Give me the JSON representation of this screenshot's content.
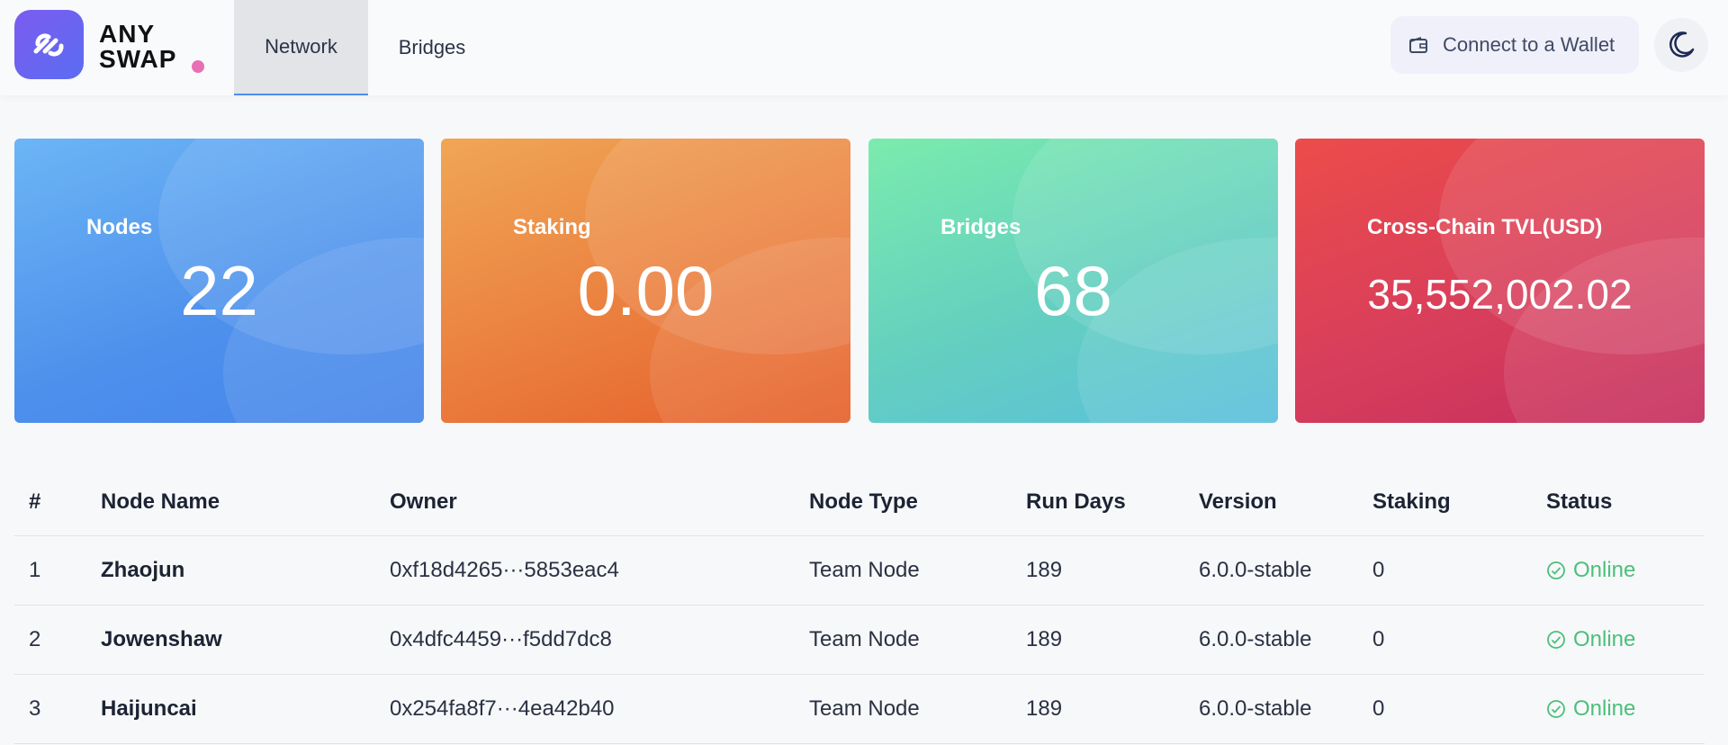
{
  "brand": {
    "line1": "ANY",
    "line2": "SWAP"
  },
  "nav": {
    "tabs": [
      {
        "label": "Network"
      },
      {
        "label": "Bridges"
      }
    ]
  },
  "header": {
    "wallet_label": "Connect to a Wallet"
  },
  "icons": {
    "logo": "swap-link-icon",
    "wallet": "wallet-icon",
    "theme": "moon-icon",
    "status": "check-circle-icon"
  },
  "colors": {
    "accent": "#4e8df0",
    "online": "#4bbf7a",
    "brand_dot": "#e86fb3"
  },
  "stats": [
    {
      "label": "Nodes",
      "value": "22"
    },
    {
      "label": "Staking",
      "value": "0.00"
    },
    {
      "label": "Bridges",
      "value": "68"
    },
    {
      "label": "Cross-Chain TVL(USD)",
      "value": "35,552,002.02"
    }
  ],
  "table": {
    "columns": [
      "#",
      "Node Name",
      "Owner",
      "Node Type",
      "Run Days",
      "Version",
      "Staking",
      "Status"
    ],
    "rows": [
      {
        "index": "1",
        "name": "Zhaojun",
        "owner": "0xf18d4265···5853eac4",
        "type": "Team Node",
        "days": "189",
        "version": "6.0.0-stable",
        "staking": "0",
        "status": "Online"
      },
      {
        "index": "2",
        "name": "Jowenshaw",
        "owner": "0x4dfc4459···f5dd7dc8",
        "type": "Team Node",
        "days": "189",
        "version": "6.0.0-stable",
        "staking": "0",
        "status": "Online"
      },
      {
        "index": "3",
        "name": "Haijuncai",
        "owner": "0x254fa8f7···4ea42b40",
        "type": "Team Node",
        "days": "189",
        "version": "6.0.0-stable",
        "staking": "0",
        "status": "Online"
      }
    ]
  }
}
